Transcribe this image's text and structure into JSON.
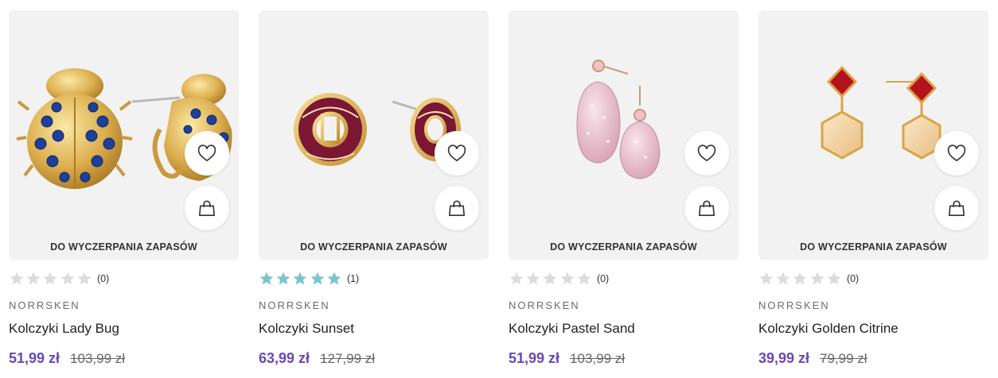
{
  "colors": {
    "card_bg": "#f2f2f2",
    "sale_price": "#6a48b3",
    "star_filled": "#79c6cc",
    "star_empty": "#dcdcdc"
  },
  "icons": {
    "wishlist": "heart-icon",
    "cart": "shopping-bag-icon",
    "rating": "star-icon"
  },
  "products": [
    {
      "stock_label": "DO WYCZERPANIA ZAPASÓW",
      "rating_value": 0,
      "rating_count": "(0)",
      "brand": "NORRSKEN",
      "name": "Kolczyki Lady Bug",
      "sale_price": "51,99 zł",
      "old_price": "103,99 zł"
    },
    {
      "stock_label": "DO WYCZERPANIA ZAPASÓW",
      "rating_value": 5,
      "rating_count": "(1)",
      "brand": "NORRSKEN",
      "name": "Kolczyki Sunset",
      "sale_price": "63,99 zł",
      "old_price": "127,99 zł"
    },
    {
      "stock_label": "DO WYCZERPANIA ZAPASÓW",
      "rating_value": 0,
      "rating_count": "(0)",
      "brand": "NORRSKEN",
      "name": "Kolczyki Pastel Sand",
      "sale_price": "51,99 zł",
      "old_price": "103,99 zł"
    },
    {
      "stock_label": "DO WYCZERPANIA ZAPASÓW",
      "rating_value": 0,
      "rating_count": "(0)",
      "brand": "NORRSKEN",
      "name": "Kolczyki Golden Citrine",
      "sale_price": "39,99 zł",
      "old_price": "79,99 zł"
    }
  ]
}
